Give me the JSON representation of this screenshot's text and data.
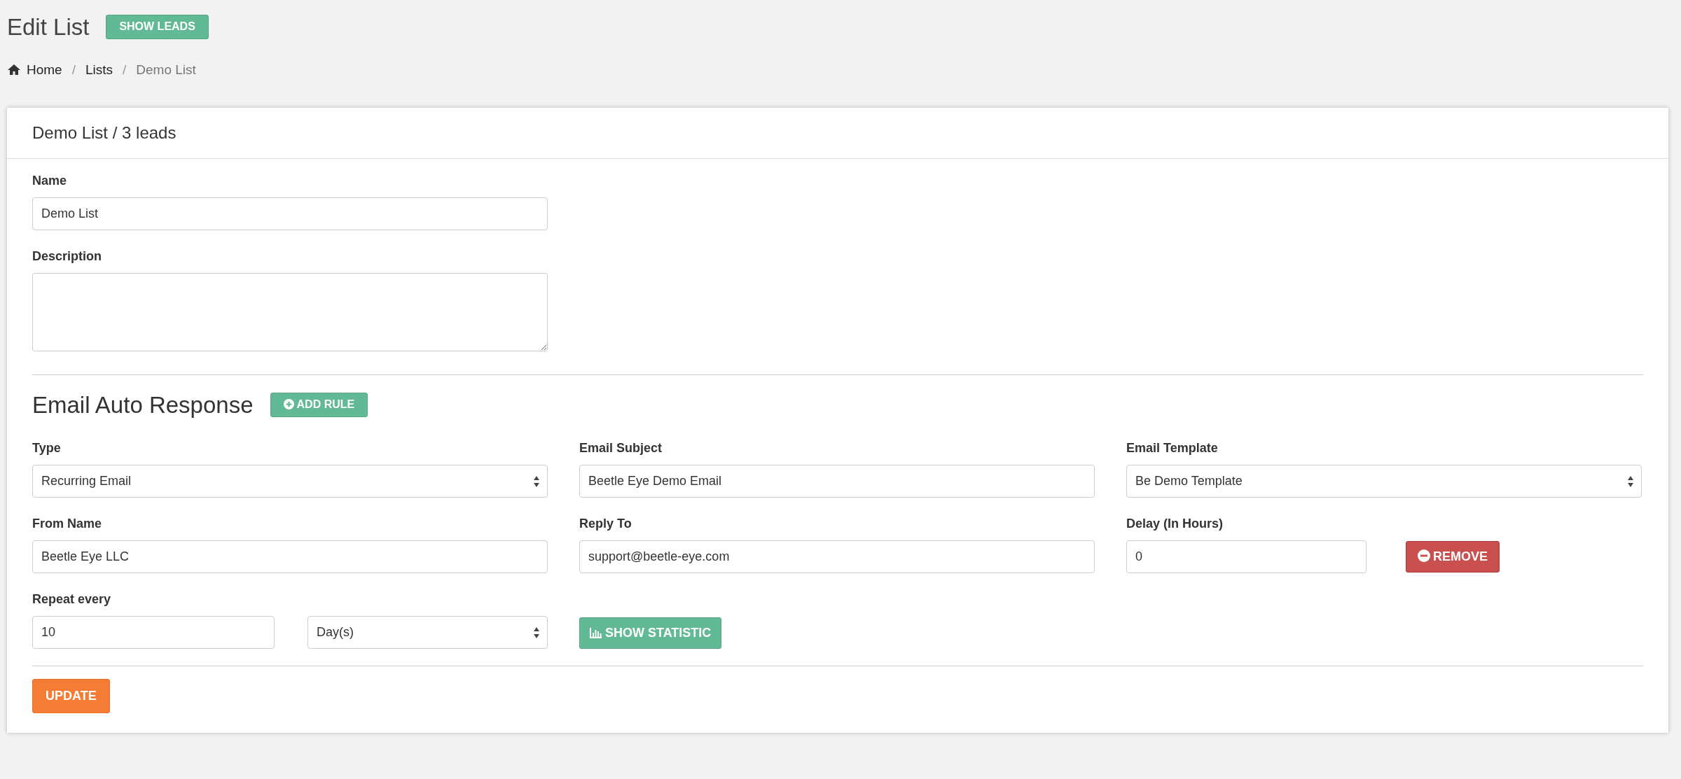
{
  "page_title": "Edit List",
  "header_button": "SHOW LEADS",
  "breadcrumb": [
    {
      "label": "Home",
      "kind": "home",
      "active": false
    },
    {
      "label": "Lists",
      "kind": "link",
      "separator": "/",
      "active": false
    },
    {
      "label": "Demo List",
      "kind": "link",
      "separator": "/",
      "active": true
    }
  ],
  "card": {
    "title": "Demo List / 3 leads",
    "fields": [
      {
        "label": "Name",
        "kind": "text",
        "value": "Demo List"
      },
      {
        "label": "Description",
        "kind": "textarea"
      }
    ]
  },
  "auto_response": {
    "title": "Email Auto Response",
    "add_button": "ADD RULE",
    "fields": [
      {
        "label": "Type",
        "kind": "select",
        "value": "Recurring Email"
      },
      {
        "label": "Email Subject",
        "kind": "text",
        "value": "Beetle Eye Demo Email"
      },
      {
        "label": "Email Template",
        "kind": "select",
        "value": "Be Demo Template"
      },
      {
        "label": "From Name",
        "kind": "text",
        "value": "Beetle Eye LLC"
      },
      {
        "label": "Reply To",
        "kind": "text",
        "value": "support@beetle-eye.com"
      },
      {
        "label": "Delay (In Hours)",
        "kind": "text",
        "value": "0"
      }
    ],
    "remove_button": "REMOVE",
    "repeat": {
      "label": "Repeat every",
      "value": "10",
      "unit": "Day(s)"
    },
    "statistic_button": "SHOW STATISTIC"
  },
  "update_button": "UPDATE"
}
